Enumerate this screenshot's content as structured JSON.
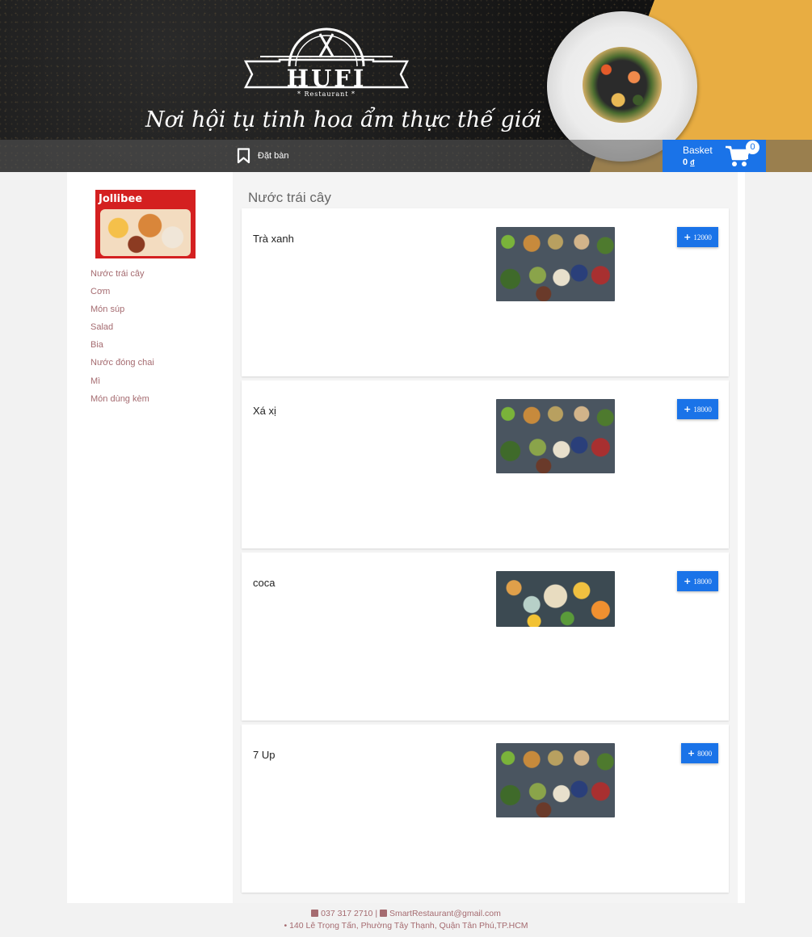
{
  "header": {
    "logo_text": "HUFI",
    "logo_sub": "* Restaurant *",
    "slogan": "Nơi hội tụ tinh hoa ẩm thực thế giới",
    "nav": {
      "booking_label": "Đặt bàn"
    },
    "basket": {
      "label": "Basket",
      "total": "0",
      "currency": "đ",
      "count": "0"
    }
  },
  "sidebar": {
    "promo_brand": "Jollibee",
    "categories": [
      "Nước trái cây",
      "Cơm",
      "Món súp",
      "Salad",
      "Bia",
      "Nước đóng chai",
      "Mì",
      "Món dùng kèm"
    ]
  },
  "main": {
    "section_title": "Nước trái cây",
    "items": [
      {
        "name": "Trà xanh",
        "price": "12000"
      },
      {
        "name": "Xá xị",
        "price": "18000"
      },
      {
        "name": "coca",
        "price": "18000"
      },
      {
        "name": "7 Up",
        "price": "8000"
      }
    ]
  },
  "footer": {
    "phone": "037 317 2710",
    "separator": "|",
    "email": "SmartRestaurant@gmail.com",
    "address": "140 Lê Trọng Tấn, Phường Tây Thạnh, Quận Tân Phú,TP.HCM"
  },
  "colors": {
    "accent": "#1a73e8",
    "header_yellow": "#e8ad42",
    "link": "#a56b70"
  }
}
